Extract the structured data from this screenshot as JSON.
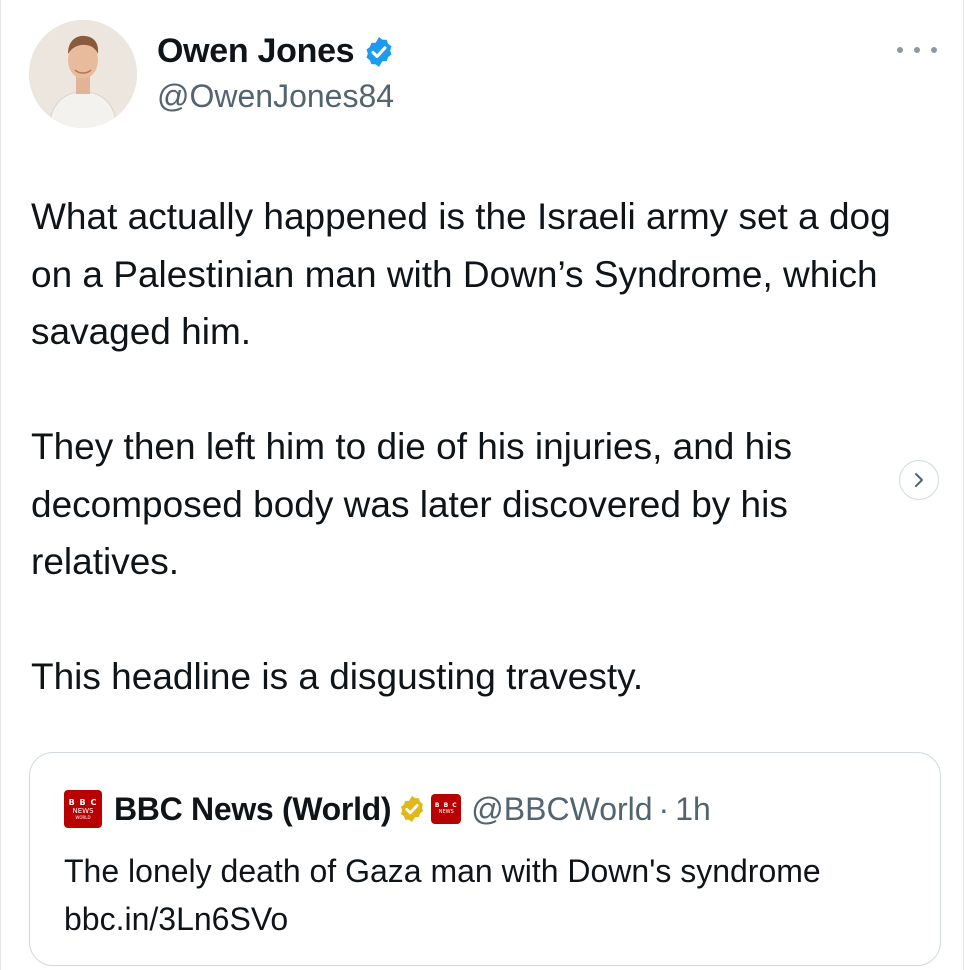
{
  "author": {
    "name": "Owen Jones",
    "handle": "@OwenJones84",
    "verified_color": "#1d9bf0"
  },
  "tweet": {
    "text": "What actually happened is the Israeli army set a dog on a Palestinian man with Down’s Syndrome, which savaged him.\n\nThey then left him to die of his injuries, and his decomposed body was later discovered by his relatives.\n\nThis headline is a disgusting travesty."
  },
  "quote": {
    "logo_text": "BBC NEWS",
    "name": "BBC News (World)",
    "handle": "@BBCWorld",
    "separator": "·",
    "time": "1h",
    "text": "The lonely death of Gaza man with Down's syndrome bbc.in/3Ln6SVo",
    "gold_check_color": "#e2b719",
    "logo_color": "#b80000"
  },
  "icons": {
    "more": "more-horizontal-icon",
    "next": "chevron-right-icon"
  }
}
